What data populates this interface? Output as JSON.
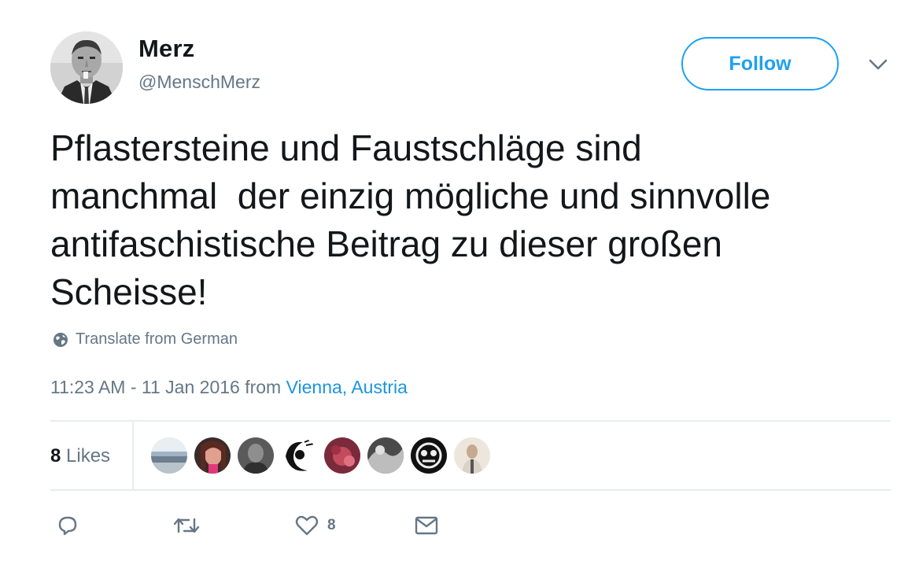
{
  "tweet": {
    "author": {
      "display_name": "Merz",
      "handle": "@MenschMerz"
    },
    "follow_label": "Follow",
    "text": "Pflastersteine und Faustschläge sind\nmanchmal  der einzig mögliche und sinnvolle\nantifaschistische Beitrag zu dieser großen\nScheisse!",
    "translate_label": "Translate from German",
    "timestamp": "11:23 AM - 11 Jan 2016",
    "from_prefix": "from",
    "location": "Vienna, Austria",
    "likes": {
      "count": "8",
      "label": "Likes"
    },
    "actions": {
      "reply_icon": "reply-icon",
      "retweet_icon": "retweet-icon",
      "like_icon": "heart-icon",
      "like_count": "8",
      "dm_icon": "envelope-icon"
    }
  },
  "colors": {
    "accent": "#1da1f2",
    "link": "#1b95e0",
    "muted": "#657786",
    "text": "#14171a",
    "divider": "#e6ecf0"
  }
}
